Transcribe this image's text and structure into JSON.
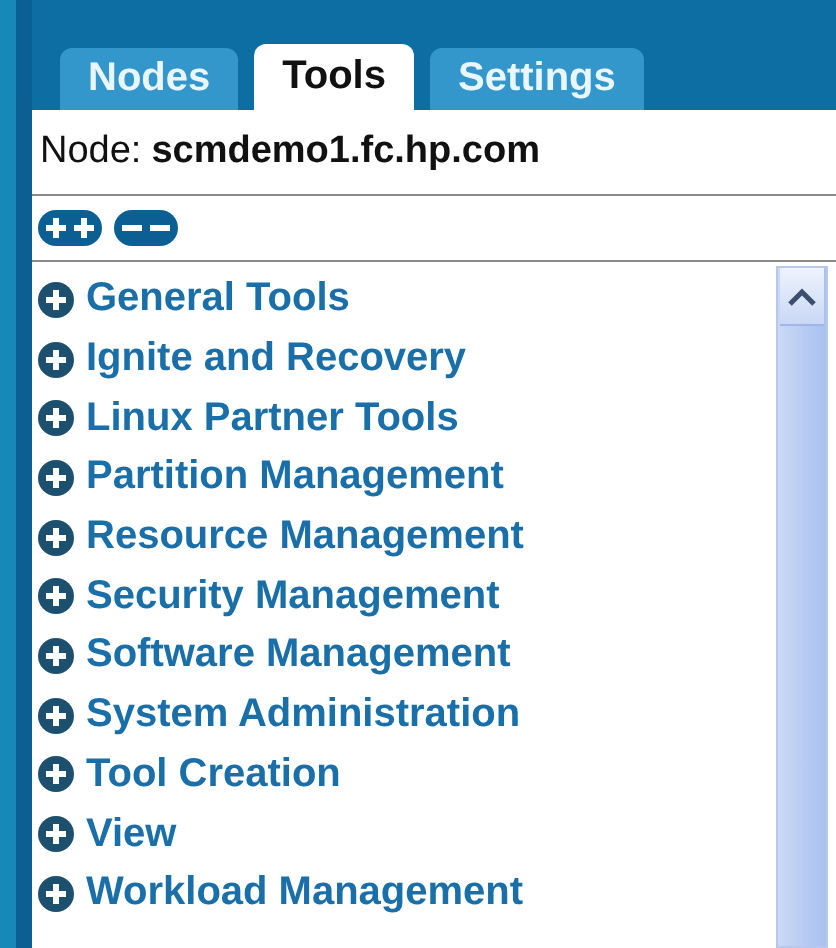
{
  "tabs": [
    {
      "label": "Nodes",
      "selected": false
    },
    {
      "label": "Tools",
      "selected": true
    },
    {
      "label": "Settings",
      "selected": false
    }
  ],
  "node": {
    "label": "Node:",
    "value": "scmdemo1.fc.hp.com"
  },
  "toolbar": {
    "buttons": [
      {
        "kind": "expand-all"
      },
      {
        "kind": "collapse-all"
      }
    ]
  },
  "tree": {
    "items": [
      {
        "label": "General Tools",
        "expanded": false
      },
      {
        "label": "Ignite and Recovery",
        "expanded": false
      },
      {
        "label": "Linux Partner Tools",
        "expanded": false
      },
      {
        "label": "Partition Management",
        "expanded": false
      },
      {
        "label": "Resource Management",
        "expanded": false
      },
      {
        "label": "Security Management",
        "expanded": false
      },
      {
        "label": "Software Management",
        "expanded": false
      },
      {
        "label": "System Administration",
        "expanded": false
      },
      {
        "label": "Tool Creation",
        "expanded": false
      },
      {
        "label": "View",
        "expanded": false
      },
      {
        "label": "Workload Management",
        "expanded": false
      }
    ]
  }
}
